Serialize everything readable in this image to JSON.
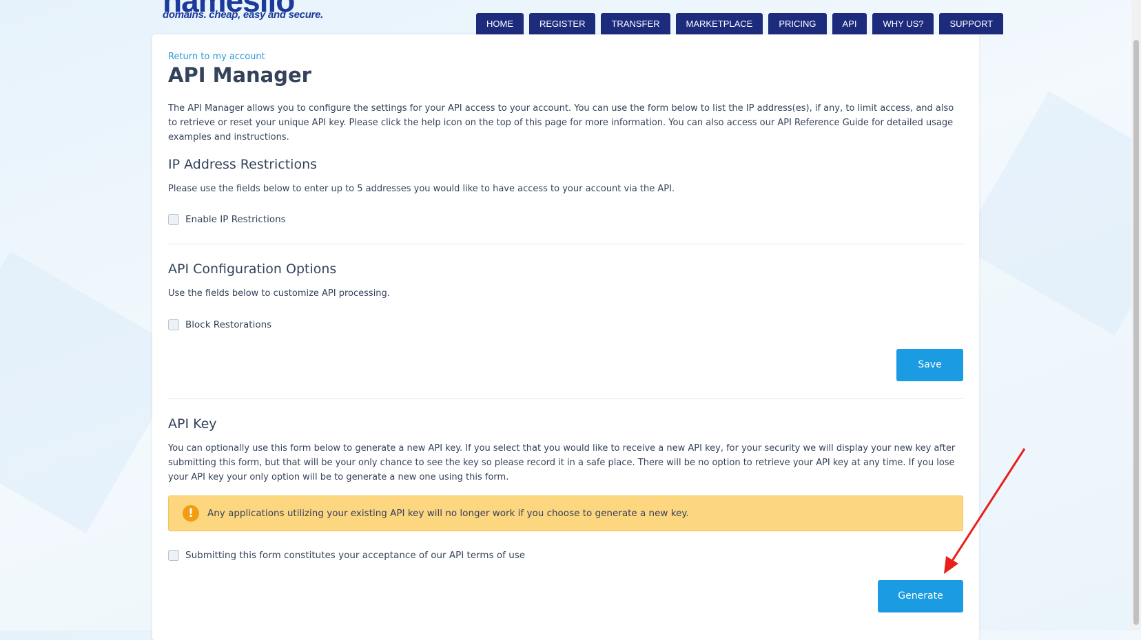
{
  "brand": {
    "logo_text": "namesilo",
    "tagline": "domains. cheap, easy and secure."
  },
  "nav": [
    "HOME",
    "REGISTER",
    "TRANSFER",
    "MARKETPLACE",
    "PRICING",
    "API",
    "WHY US?",
    "SUPPORT"
  ],
  "page": {
    "return_link": "Return to my account",
    "title": "API Manager",
    "intro": "The API Manager allows you to configure the settings for your API access to your account. You can use the form below to list the IP address(es), if any, to limit access, and also to retrieve or reset your unique API key. Please click the help icon on the top of this page for more information. You can also access our API Reference Guide for detailed usage examples and instructions."
  },
  "ip_section": {
    "heading": "IP Address Restrictions",
    "description": "Please use the fields below to enter up to 5 addresses you would like to have access to your account via the API.",
    "checkbox_label": "Enable IP Restrictions"
  },
  "config_section": {
    "heading": "API Configuration Options",
    "description": "Use the fields below to customize API processing.",
    "checkbox_label": "Block Restorations",
    "save_label": "Save"
  },
  "key_section": {
    "heading": "API Key",
    "description": "You can optionally use this form below to generate a new API key. If you select that you would like to receive a new API key, for your security we will display your new key after submitting this form, but that will be your only chance to see the key so please record it in a safe place. There will be no option to retrieve your API key at any time. If you lose your API key your only option will be to generate a new one using this form.",
    "alert_icon": "!",
    "alert_text": "Any applications utilizing your existing API key will no longer work if you choose to generate a new key.",
    "terms_label": "Submitting this form constitutes your acceptance of our API terms of use",
    "generate_label": "Generate"
  },
  "colors": {
    "nav_bg": "#1d2b7d",
    "button": "#1a9be2",
    "alert_bg": "#fdd680",
    "link": "#2a9ad8",
    "annotation_arrow": "#e8201a"
  }
}
